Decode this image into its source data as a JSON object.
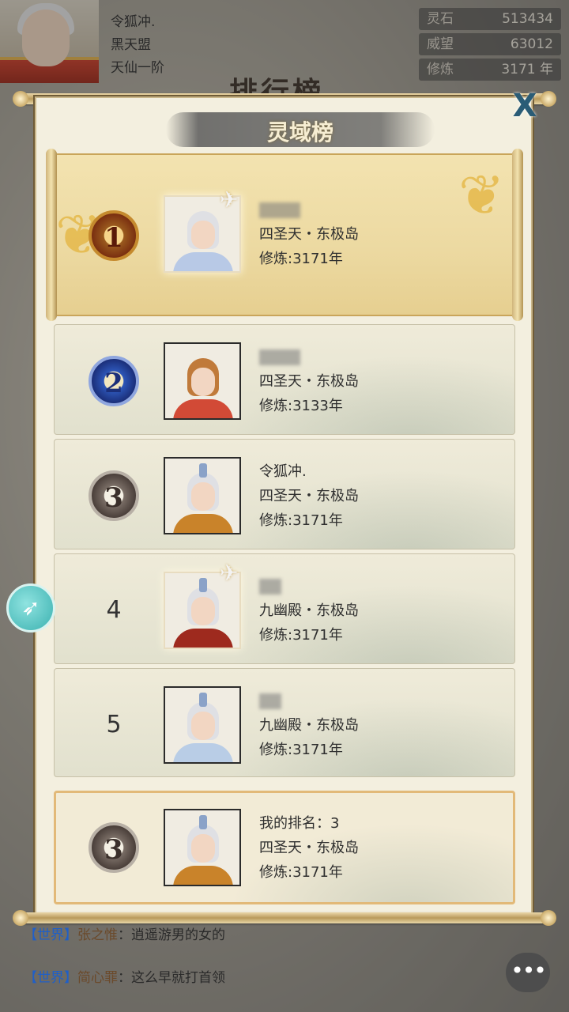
{
  "player": {
    "name": "令狐冲.",
    "guild": "黑天盟",
    "realm": "天仙一阶"
  },
  "stats": [
    {
      "label": "灵石",
      "value": "513434"
    },
    {
      "label": "威望",
      "value": "63012"
    },
    {
      "label": "修炼",
      "value": "3171 年"
    }
  ],
  "background_title": "排行榜",
  "panel": {
    "title": "灵域榜",
    "close_label": "X"
  },
  "ranks": [
    {
      "rank": "1",
      "name": "",
      "region": "四圣天・东极岛",
      "cultivation": "修炼:3171年",
      "medal": "gold",
      "robe_color": "#b8c9e6"
    },
    {
      "rank": "2",
      "name": "",
      "region": "四圣天・东极岛",
      "cultivation": "修炼:3133年",
      "medal": "blue",
      "robe_color": "#d24a36"
    },
    {
      "rank": "3",
      "name": "令狐冲.",
      "region": "四圣天・东极岛",
      "cultivation": "修炼:3171年",
      "medal": "silver",
      "robe_color": "#c9832a"
    },
    {
      "rank": "4",
      "name": "",
      "region": "九幽殿・东极岛",
      "cultivation": "修炼:3171年",
      "medal": "none",
      "robe_color": "#9e2a1e"
    },
    {
      "rank": "5",
      "name": "",
      "region": "九幽殿・东极岛",
      "cultivation": "修炼:3171年",
      "medal": "none",
      "robe_color": "#b9cde6"
    }
  ],
  "my_rank": {
    "rank": "3",
    "label": "我的排名：3",
    "region": "四圣天・东极岛",
    "cultivation": "修炼:3171年"
  },
  "chat": [
    {
      "channel": "【世界】",
      "speaker": "张之惟",
      "message": "：逍遥游男的女的"
    },
    {
      "channel": "【世界】",
      "speaker": "简心罪",
      "message": "：这么早就打首领"
    }
  ],
  "icons": [
    "rocket-icon",
    "chat-bubble-icon",
    "close-icon",
    "crane-icon",
    "phoenix-icon"
  ]
}
